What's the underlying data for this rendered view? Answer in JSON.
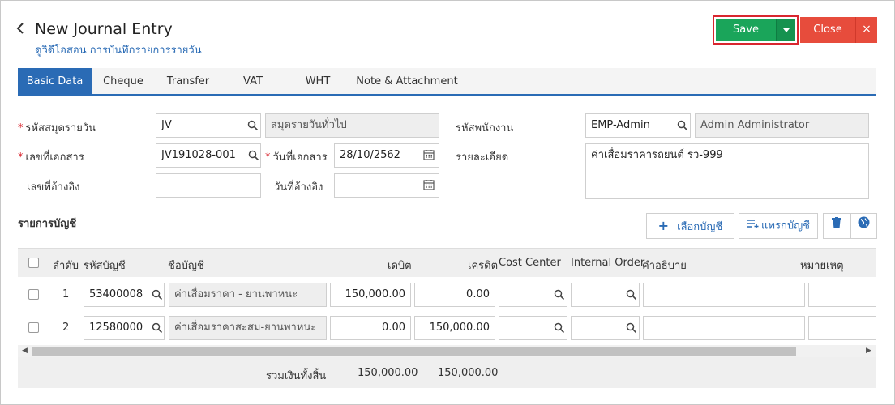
{
  "header": {
    "back_label": "<",
    "title": "New Journal Entry",
    "subtitle": "ดูวิดีโอสอน การบันทึกรายการรายวัน",
    "save_label": "Save",
    "close_label": "Close",
    "close_x": "×"
  },
  "tabs": [
    "Basic Data",
    "Cheque",
    "Transfer",
    "VAT",
    "WHT",
    "Note & Attachment"
  ],
  "form": {
    "journal_code_label": "รหัสสมุดรายวัน",
    "journal_code_value": "JV",
    "journal_name_value": "สมุดรายวันทั่วไป",
    "employee_label": "รหัสพนักงาน",
    "employee_code_value": "EMP-Admin",
    "employee_name_value": "Admin Administrator",
    "doc_no_label": "เลขที่เอกสาร",
    "doc_no_value": "JV191028-001",
    "doc_date_label": "วันที่เอกสาร",
    "doc_date_value": "28/10/2562",
    "description_label": "รายละเอียด",
    "description_value": "ค่าเสื่อมราคารถยนต์ รว-999",
    "ref_no_label": "เลขที่อ้างอิง",
    "ref_no_value": "",
    "ref_date_label": "วันที่อ้างอิง",
    "ref_date_value": ""
  },
  "accounts": {
    "section_title": "รายการบัญชี",
    "select_account_label": "เลือกบัญชี",
    "insert_account_label": "แทรกบัญชี",
    "columns": [
      "ลำดับ",
      "รหัสบัญชี",
      "ชื่อบัญชี",
      "เดบิต",
      "เครดิต",
      "Cost Center",
      "Internal Order",
      "คำอธิบาย",
      "หมายเหตุ"
    ],
    "rows": [
      {
        "no": "1",
        "code": "53400008",
        "name": "ค่าเสื่อมราคา - ยานพาหนะ",
        "debit": "150,000.00",
        "credit": "0.00"
      },
      {
        "no": "2",
        "code": "12580000",
        "name": "ค่าเสื่อมราคาสะสม-ยานพาหนะ",
        "debit": "0.00",
        "credit": "150,000.00"
      }
    ],
    "total_label": "รวมเงินทั้งสิ้น",
    "total_debit": "150,000.00",
    "total_credit": "150,000.00"
  },
  "colors": {
    "primary": "#2a6bb5",
    "save": "#1aa55a",
    "close": "#e74c3c",
    "required": "#d9262f"
  },
  "icons": [
    "back-chevron-icon",
    "caret-down-icon",
    "search-icon",
    "calendar-icon",
    "plus-icon",
    "insert-list-icon",
    "trash-icon",
    "globe-icon"
  ]
}
